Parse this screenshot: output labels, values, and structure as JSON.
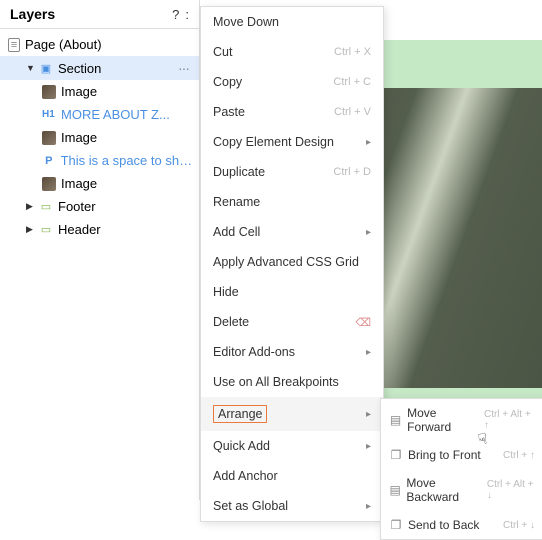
{
  "header": {
    "title": "Layers",
    "help": "?",
    "close": ":"
  },
  "tree": {
    "page": "Page (About)",
    "section": "Section",
    "image1": "Image",
    "h1": "MORE ABOUT Z...",
    "image2": "Image",
    "para": "This is a space to sha...",
    "image3": "Image",
    "footer": "Footer",
    "headerLayer": "Header"
  },
  "menu": {
    "moveDown": "Move Down",
    "cut": "Cut",
    "copy": "Copy",
    "paste": "Paste",
    "copyDesign": "Copy Element Design",
    "duplicate": "Duplicate",
    "rename": "Rename",
    "addCell": "Add Cell",
    "applyGrid": "Apply Advanced CSS Grid",
    "hide": "Hide",
    "delete": "Delete",
    "addons": "Editor Add-ons",
    "useAll": "Use on All Breakpoints",
    "arrange": "Arrange",
    "quickAdd": "Quick Add",
    "addAnchor": "Add Anchor",
    "setGlobal": "Set as Global"
  },
  "shortcuts": {
    "cut": "Ctrl + X",
    "copy": "Ctrl + C",
    "paste": "Ctrl + V",
    "duplicate": "Ctrl + D"
  },
  "submenu": {
    "forward": "Move Forward",
    "front": "Bring to Front",
    "backward": "Move Backward",
    "back": "Send to Back"
  },
  "subShortcuts": {
    "forward": "Ctrl + Alt + ↑",
    "front": "Ctrl + ↑",
    "backward": "Ctrl + Alt + ↓",
    "back": "Ctrl + ↓"
  }
}
